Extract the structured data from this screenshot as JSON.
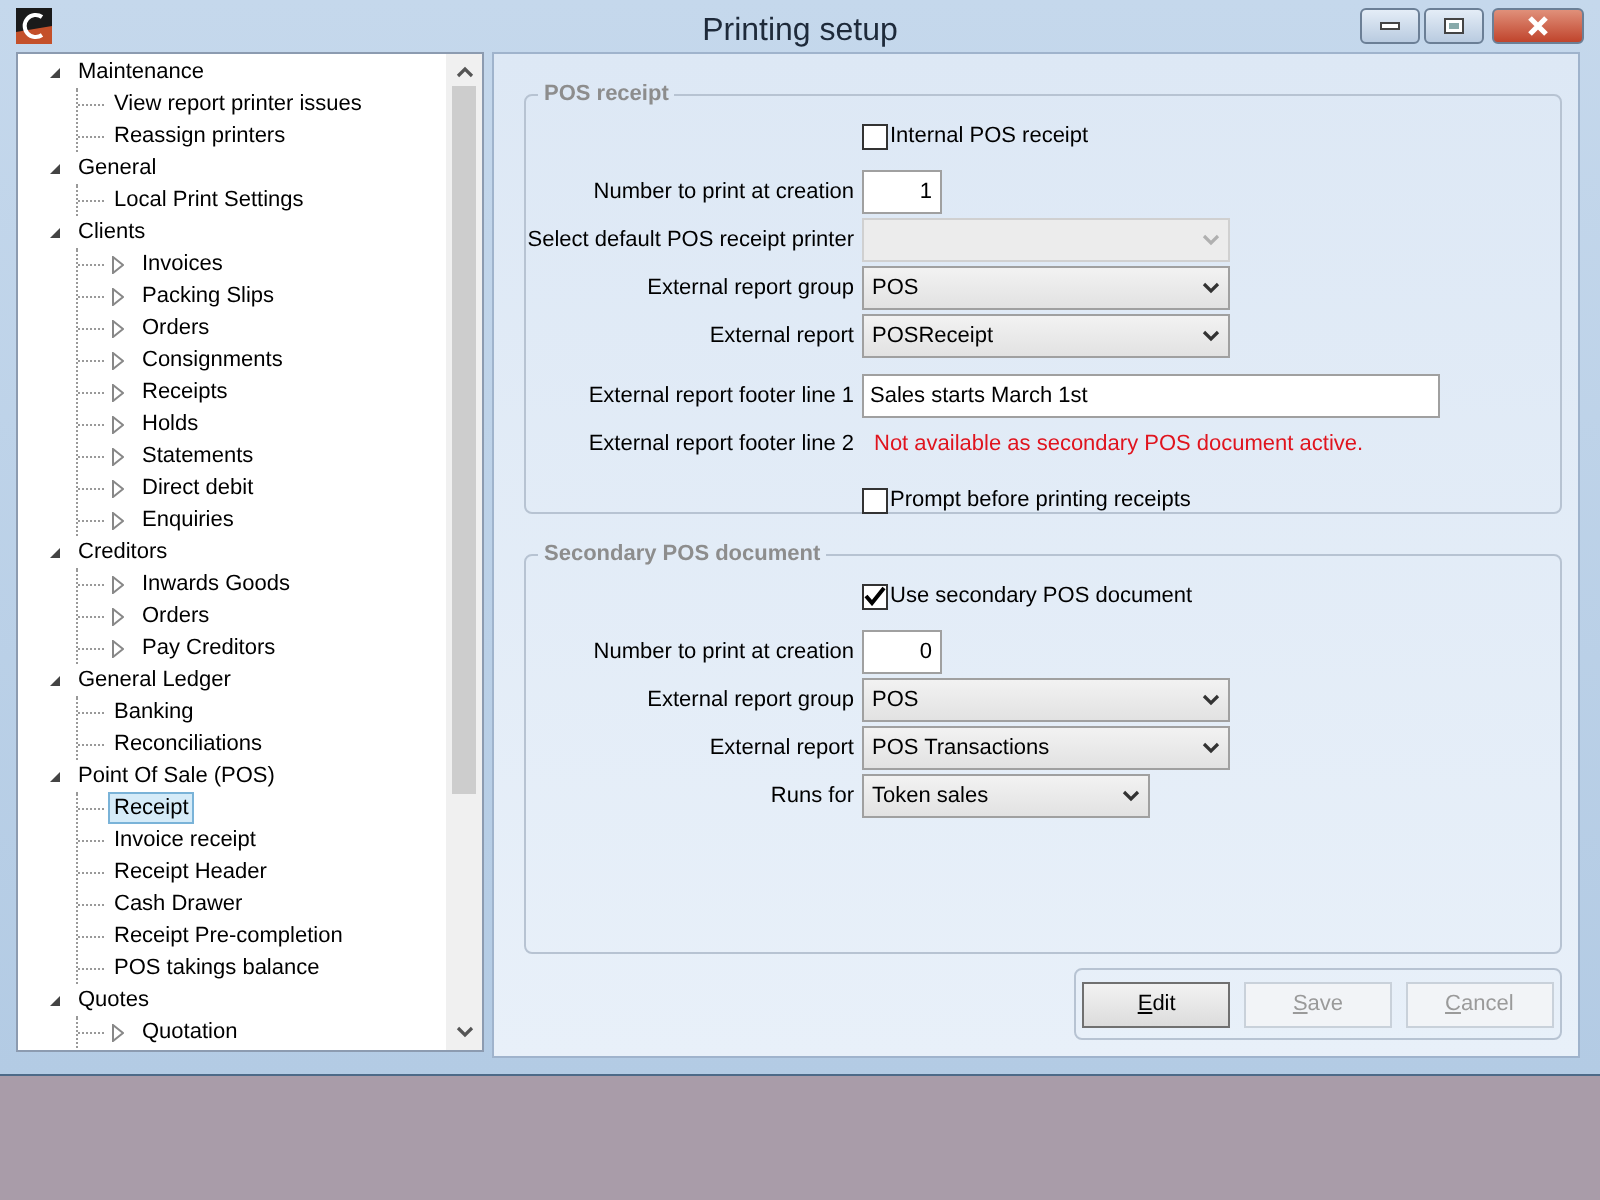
{
  "window": {
    "title": "Printing setup",
    "controls": [
      {
        "kind": "minimize"
      },
      {
        "kind": "maximize"
      },
      {
        "kind": "close"
      }
    ]
  },
  "tree": [
    {
      "label": "Maintenance",
      "expanded": true,
      "selected": false,
      "children": [
        {
          "label": "View report printer issues",
          "selected": false
        },
        {
          "label": "Reassign printers",
          "selected": false
        }
      ]
    },
    {
      "label": "General",
      "expanded": true,
      "selected": false,
      "children": [
        {
          "label": "Local Print Settings",
          "selected": false
        }
      ]
    },
    {
      "label": "Clients",
      "expanded": true,
      "selected": false,
      "children": [
        {
          "label": "Invoices",
          "expanded": false,
          "selected": false
        },
        {
          "label": "Packing Slips",
          "expanded": false,
          "selected": false
        },
        {
          "label": "Orders",
          "expanded": false,
          "selected": false
        },
        {
          "label": "Consignments",
          "expanded": false,
          "selected": false
        },
        {
          "label": "Receipts",
          "expanded": false,
          "selected": false
        },
        {
          "label": "Holds",
          "expanded": false,
          "selected": false
        },
        {
          "label": "Statements",
          "expanded": false,
          "selected": false
        },
        {
          "label": "Direct debit",
          "expanded": false,
          "selected": false
        },
        {
          "label": "Enquiries",
          "expanded": false,
          "selected": false
        }
      ]
    },
    {
      "label": "Creditors",
      "expanded": true,
      "selected": false,
      "children": [
        {
          "label": "Inwards Goods",
          "expanded": false,
          "selected": false
        },
        {
          "label": "Orders",
          "expanded": false,
          "selected": false
        },
        {
          "label": "Pay Creditors",
          "expanded": false,
          "selected": false
        }
      ]
    },
    {
      "label": "General Ledger",
      "expanded": true,
      "selected": false,
      "children": [
        {
          "label": "Banking",
          "selected": false
        },
        {
          "label": "Reconciliations",
          "selected": false
        }
      ]
    },
    {
      "label": "Point Of Sale (POS)",
      "expanded": true,
      "selected": false,
      "children": [
        {
          "label": "Receipt",
          "selected": true
        },
        {
          "label": "Invoice receipt",
          "selected": false
        },
        {
          "label": "Receipt Header",
          "selected": false
        },
        {
          "label": "Cash Drawer",
          "selected": false
        },
        {
          "label": "Receipt Pre-completion",
          "selected": false
        },
        {
          "label": "POS takings balance",
          "selected": false
        }
      ]
    },
    {
      "label": "Quotes",
      "expanded": true,
      "selected": false,
      "children": [
        {
          "label": "Quotation",
          "expanded": false,
          "selected": false
        }
      ]
    }
  ],
  "groups": [
    {
      "title": "POS receipt",
      "rows": [
        {
          "kind": "checkbox",
          "label": "Internal POS receipt",
          "checked": false
        },
        {
          "kind": "number",
          "label": "Number to print at creation",
          "value": "1"
        },
        {
          "kind": "select",
          "label": "Select default POS receipt printer",
          "value": "",
          "disabled": true
        },
        {
          "kind": "select",
          "label": "External report group",
          "value": "POS",
          "disabled": false
        },
        {
          "kind": "select",
          "label": "External report",
          "value": "POSReceipt",
          "disabled": false
        },
        {
          "kind": "text",
          "label": "External report footer line 1",
          "value": "Sales starts March 1st"
        },
        {
          "kind": "note",
          "label": "External report footer line 2",
          "value": "Not available as secondary POS document active."
        },
        {
          "kind": "checkbox",
          "label": "Prompt before printing receipts",
          "checked": false
        }
      ]
    },
    {
      "title": "Secondary POS document",
      "rows": [
        {
          "kind": "checkbox",
          "label": "Use secondary POS document",
          "checked": true
        },
        {
          "kind": "number",
          "label": "Number to print at creation",
          "value": "0"
        },
        {
          "kind": "select",
          "label": "External report group",
          "value": "POS",
          "disabled": false
        },
        {
          "kind": "select",
          "label": "External report",
          "value": "POS Transactions",
          "disabled": false
        },
        {
          "kind": "shortselect",
          "label": "Runs for",
          "value": "Token sales",
          "disabled": false
        }
      ]
    }
  ],
  "buttons": [
    {
      "label": "Edit",
      "disabled": false
    },
    {
      "label": "Save",
      "disabled": true
    },
    {
      "label": "Cancel",
      "disabled": true
    }
  ]
}
